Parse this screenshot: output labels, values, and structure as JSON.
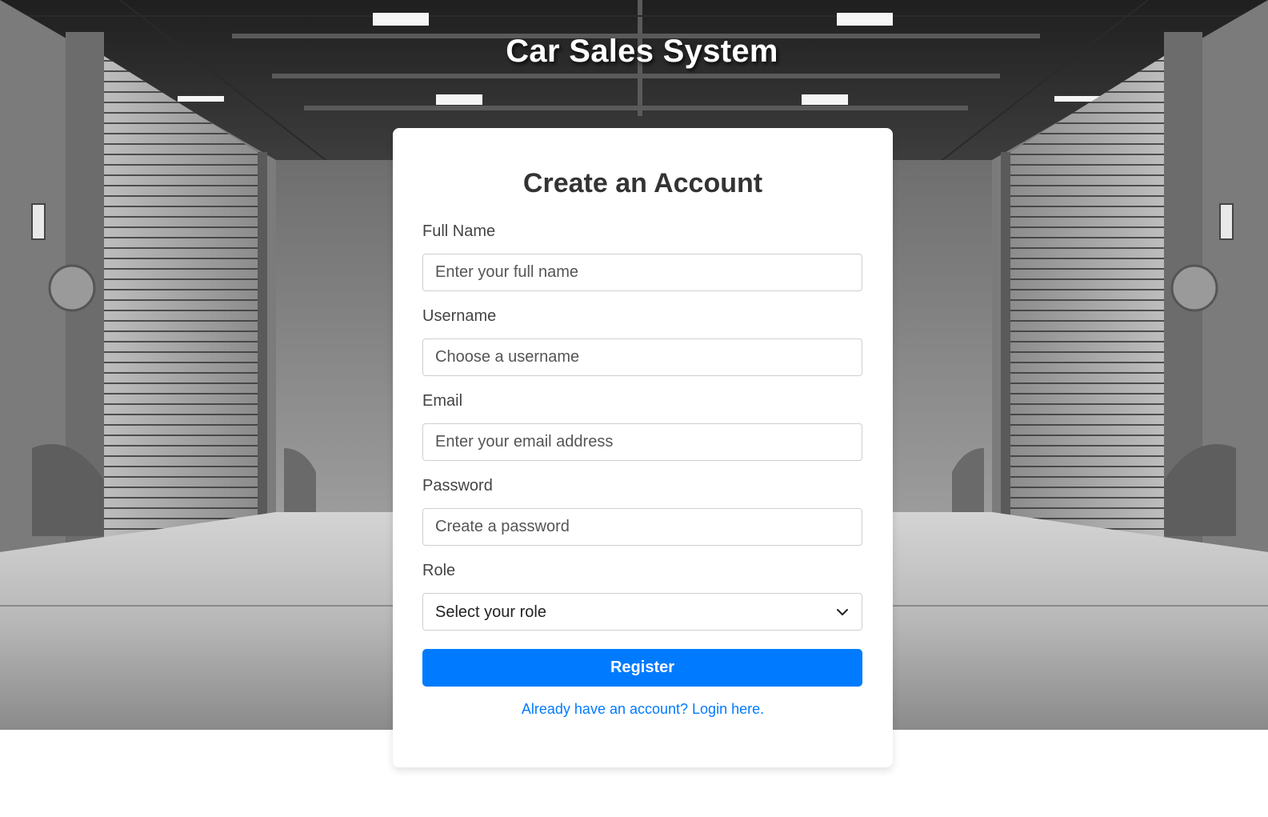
{
  "header": {
    "title": "Car Sales System"
  },
  "form": {
    "title": "Create an Account",
    "fields": [
      {
        "label": "Full Name",
        "placeholder": "Enter your full name",
        "type": "text"
      },
      {
        "label": "Username",
        "placeholder": "Choose a username",
        "type": "text"
      },
      {
        "label": "Email",
        "placeholder": "Enter your email address",
        "type": "email"
      },
      {
        "label": "Password",
        "placeholder": "Create a password",
        "type": "password"
      }
    ],
    "role": {
      "label": "Role",
      "selected": "Select your role"
    },
    "submit_label": "Register",
    "login_link": "Already have an account? Login here."
  },
  "colors": {
    "primary": "#007bff",
    "card_background": "#ffffff",
    "title_text": "#333333",
    "header_text": "#ffffff"
  },
  "icons": {
    "role_dropdown": "chevron-down-icon"
  }
}
